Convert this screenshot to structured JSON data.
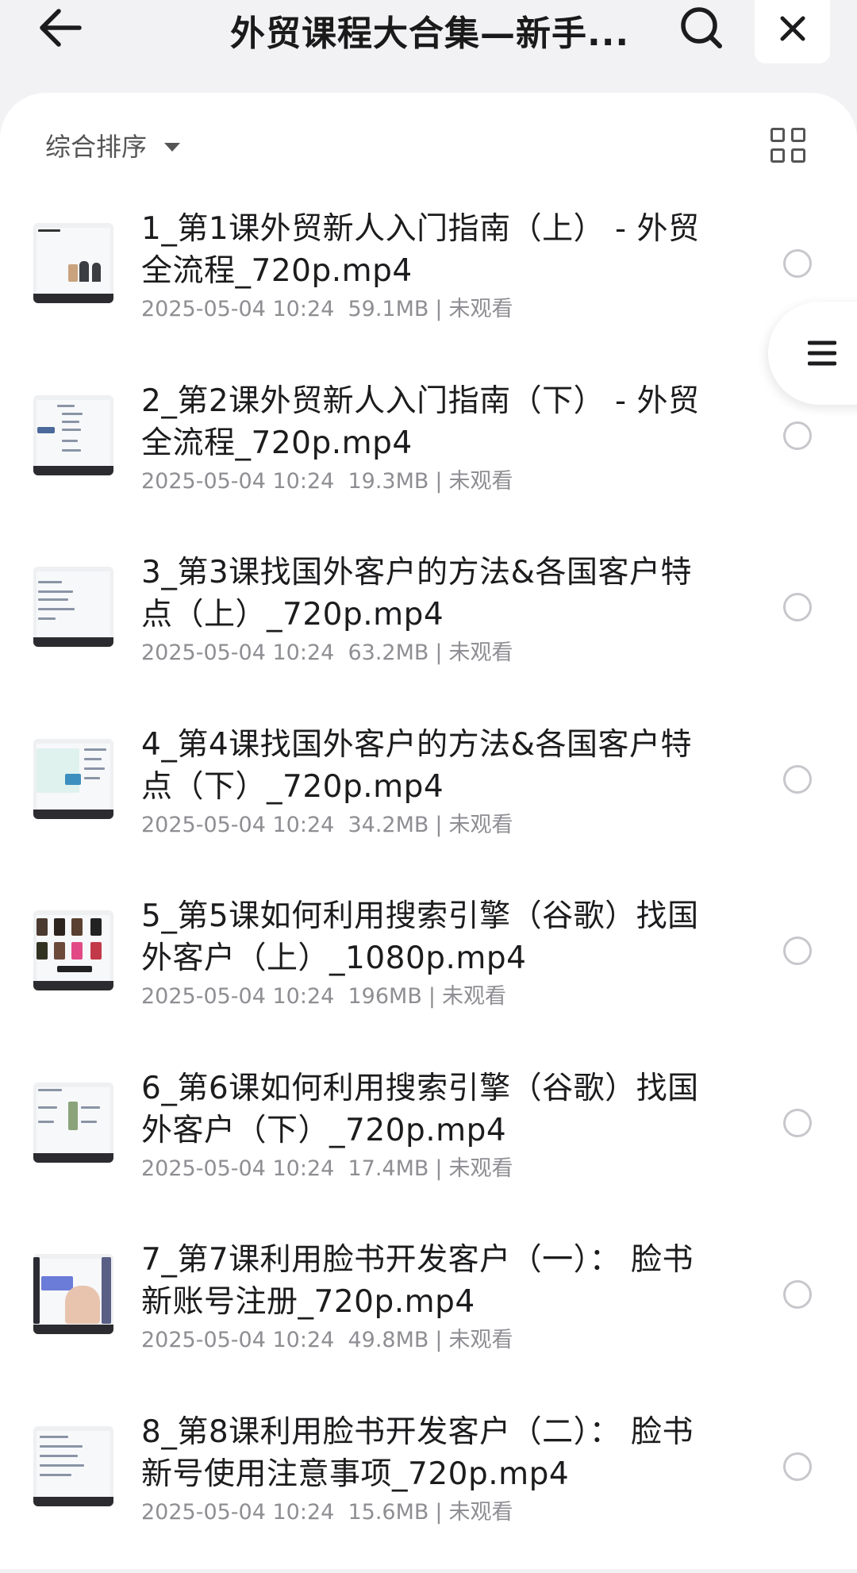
{
  "header": {
    "title": "外贸课程大合集—新手...",
    "back_icon": "arrow-left-icon",
    "search_icon": "search-icon",
    "close_icon": "close-icon"
  },
  "toolbar": {
    "sort_label": "综合排序",
    "sort_icon": "caret-down-icon",
    "view_icon": "grid-view-icon"
  },
  "floating_handle": {
    "icon": "menu-icon"
  },
  "files": [
    {
      "name": "1_第1课外贸新人入门指南（上） - 外贸全流程_720p.mp4",
      "date": "2025-05-04 10:24",
      "size": "59.1MB",
      "status": "未观看"
    },
    {
      "name": "2_第2课外贸新人入门指南（下） - 外贸全流程_720p.mp4",
      "date": "2025-05-04 10:24",
      "size": "19.3MB",
      "status": "未观看"
    },
    {
      "name": "3_第3课找国外客户的方法&各国客户特点（上）_720p.mp4",
      "date": "2025-05-04 10:24",
      "size": "63.2MB",
      "status": "未观看"
    },
    {
      "name": "4_第4课找国外客户的方法&各国客户特点（下）_720p.mp4",
      "date": "2025-05-04 10:24",
      "size": "34.2MB",
      "status": "未观看"
    },
    {
      "name": "5_第5课如何利用搜索引擎（谷歌）找国外客户（上）_1080p.mp4",
      "date": "2025-05-04 10:24",
      "size": "196MB",
      "status": "未观看"
    },
    {
      "name": "6_第6课如何利用搜索引擎（谷歌）找国外客户（下）_720p.mp4",
      "date": "2025-05-04 10:24",
      "size": "17.4MB",
      "status": "未观看"
    },
    {
      "name": "7_第7课利用脸书开发客户（一）： 脸书新账号注册_720p.mp4",
      "date": "2025-05-04 10:24",
      "size": "49.8MB",
      "status": "未观看"
    },
    {
      "name": "8_第8课利用脸书开发客户（二）： 脸书新号使用注意事项_720p.mp4",
      "date": "2025-05-04 10:24",
      "size": "15.6MB",
      "status": "未观看"
    }
  ]
}
